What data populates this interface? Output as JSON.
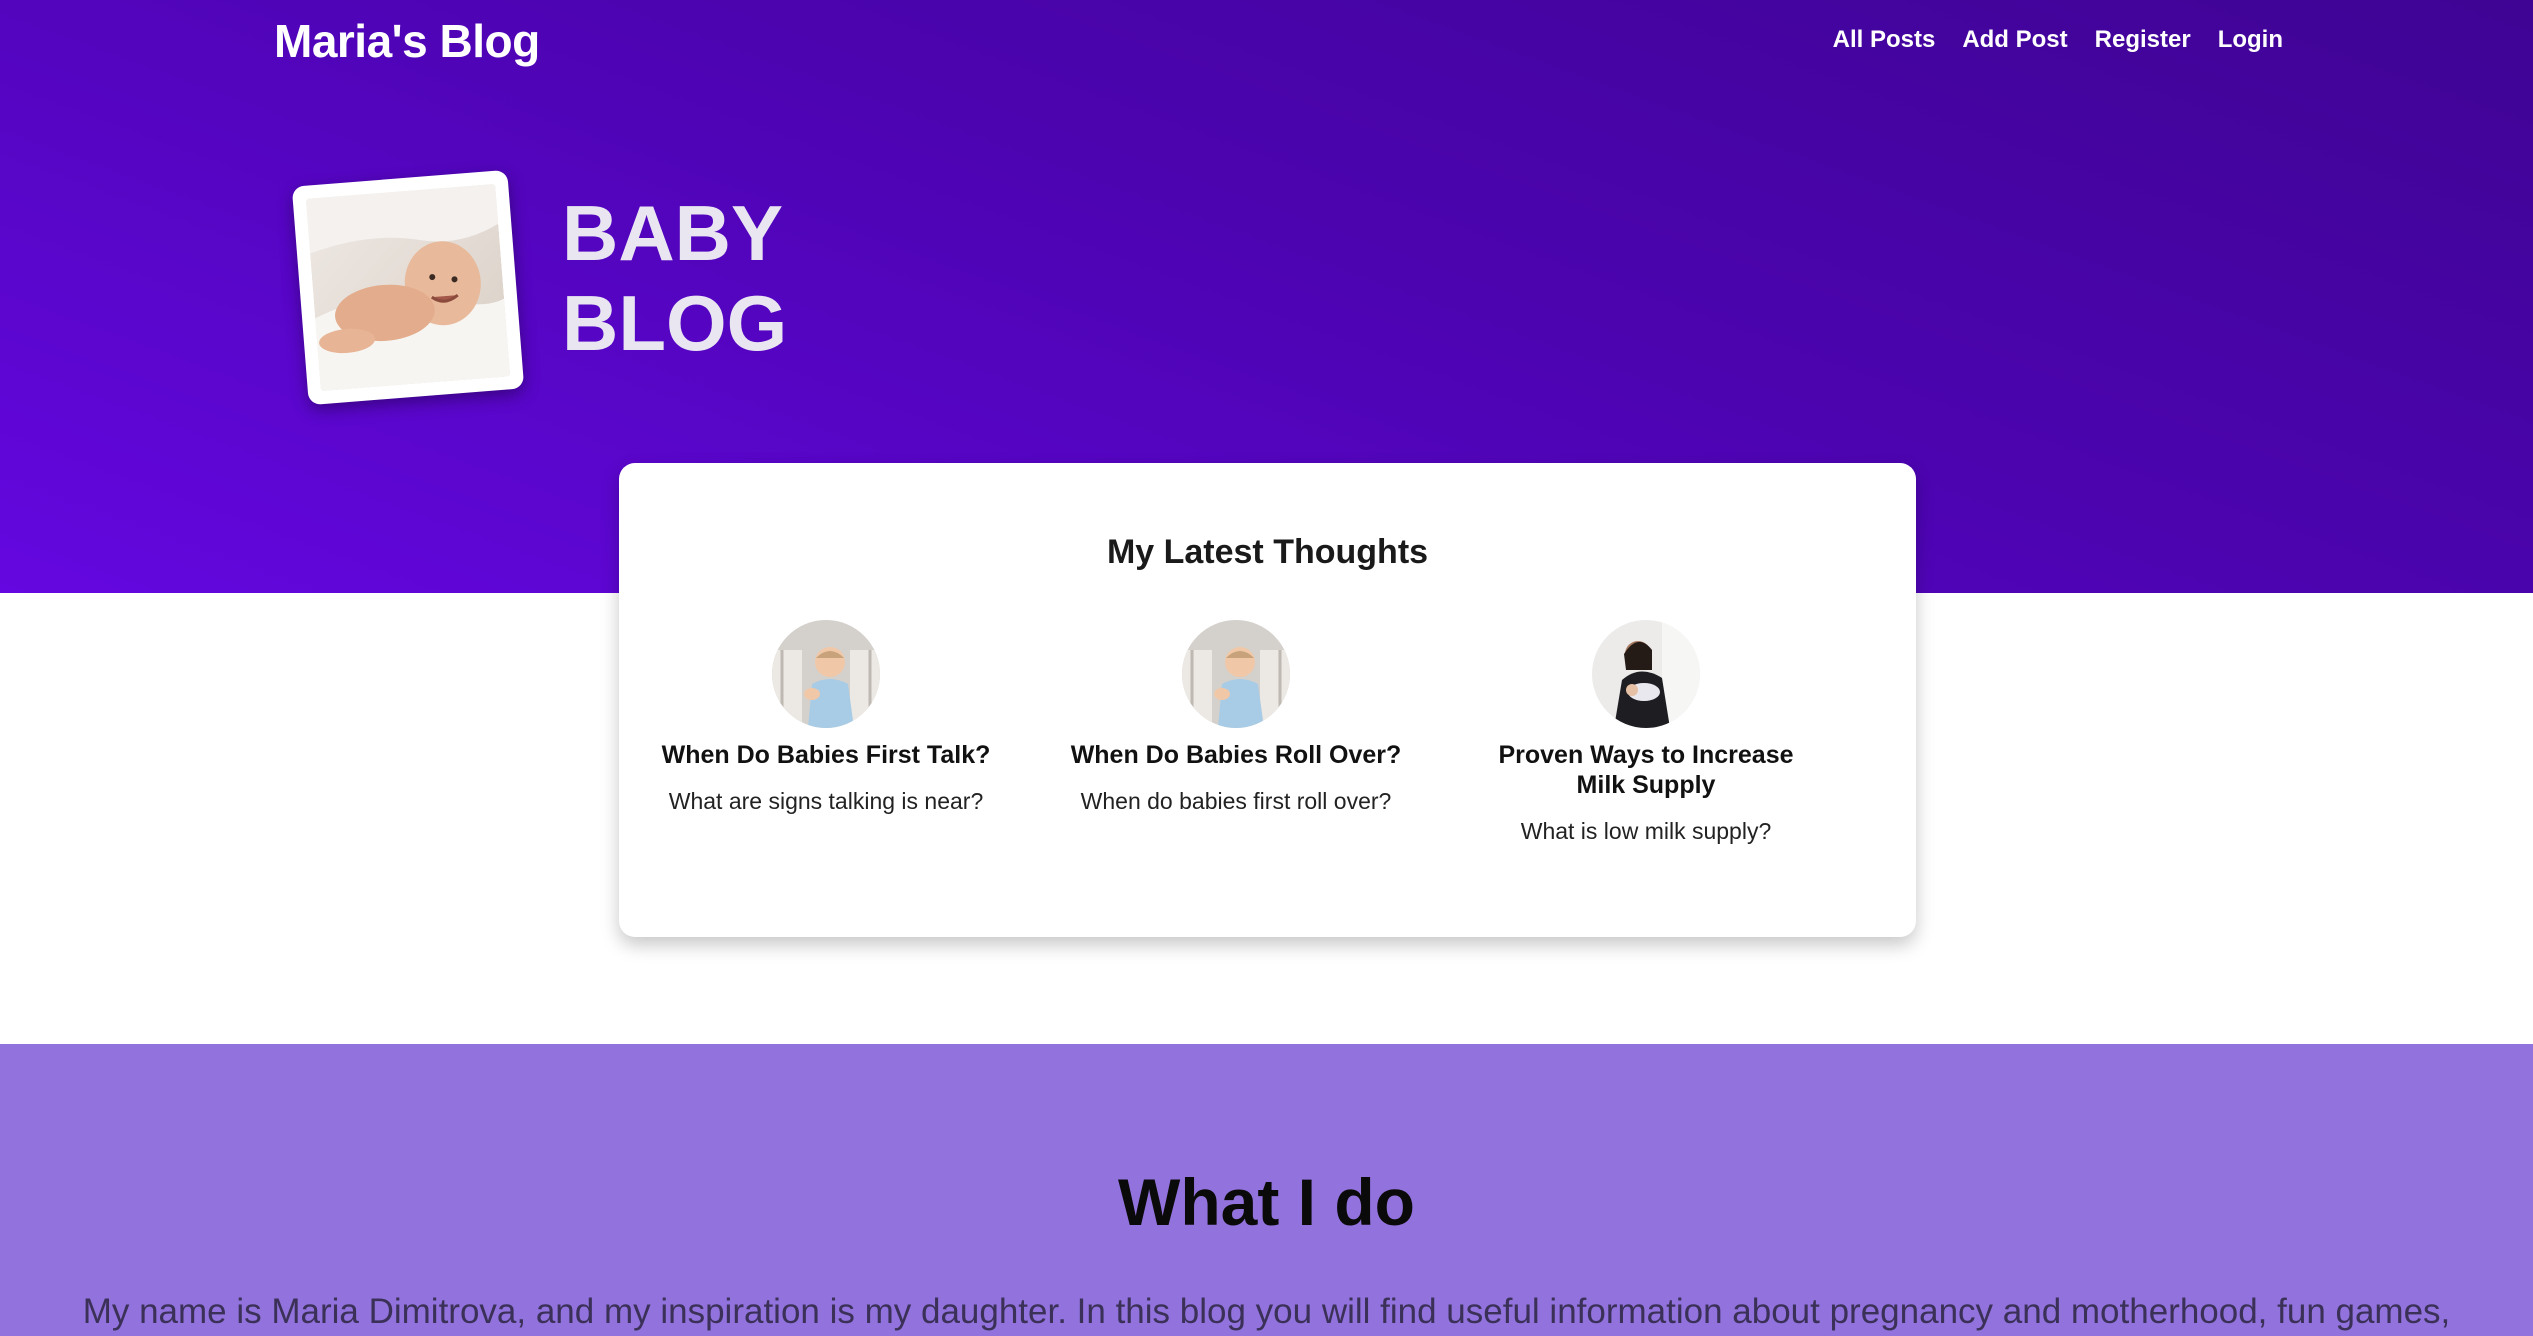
{
  "header": {
    "brand": "Maria's Blog",
    "nav": [
      "All Posts",
      "Add Post",
      "Register",
      "Login"
    ]
  },
  "hero": {
    "title_line1": "BABY",
    "title_line2": "BLOG"
  },
  "latest": {
    "heading": "My Latest Thoughts",
    "posts": [
      {
        "title": "When Do Babies First Talk?",
        "subtitle": "What are signs talking is near?"
      },
      {
        "title": "When Do Babies Roll Over?",
        "subtitle": "When do babies first roll over?"
      },
      {
        "title": "Proven Ways to Increase Milk Supply",
        "subtitle": "What is low milk supply?"
      }
    ]
  },
  "about": {
    "heading": "What I do",
    "text": "My name is Maria Dimitrova, and my inspiration is my daughter. In this blog you will find useful information about pregnancy and motherhood, fun games,"
  },
  "colors": {
    "hero_gradient_start": "#6407e0",
    "hero_gradient_end": "#3f0494",
    "about_bg": "#9272dc"
  }
}
